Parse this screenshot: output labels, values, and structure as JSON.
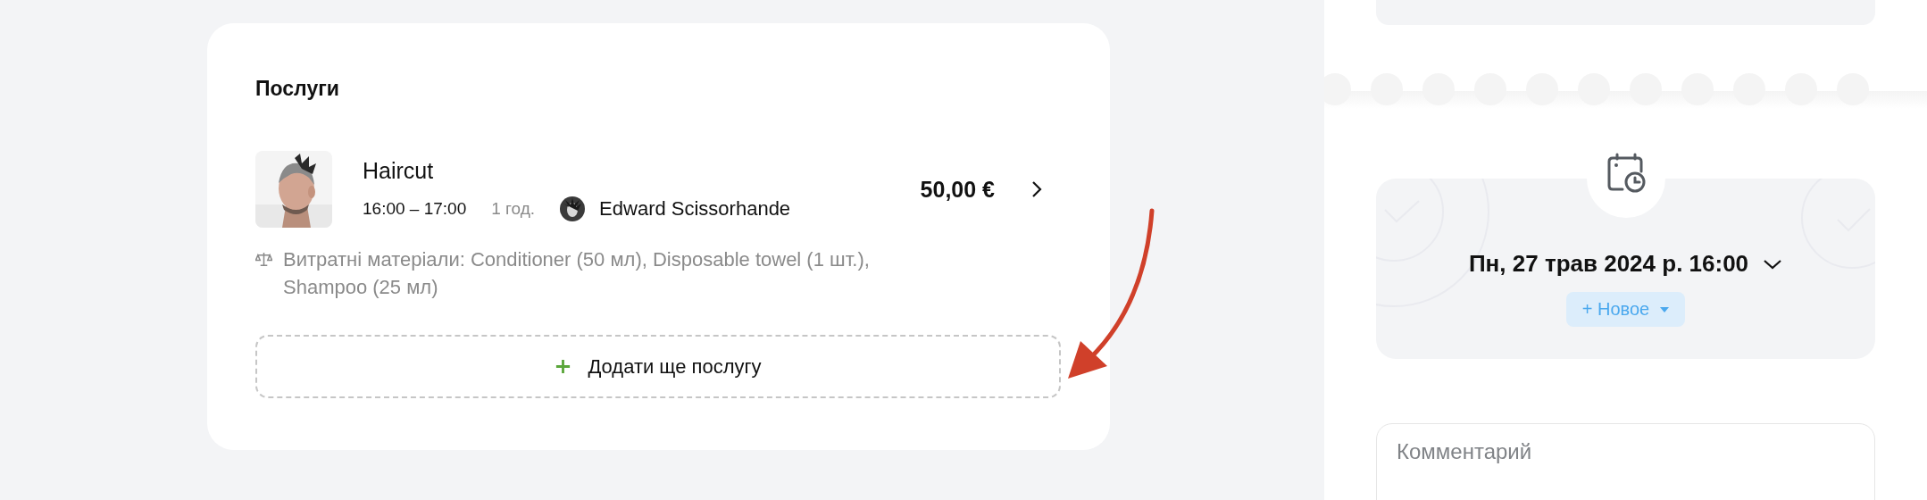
{
  "services": {
    "title": "Послуги",
    "items": [
      {
        "name": "Haircut",
        "time": "16:00 – 17:00",
        "duration": "1 год.",
        "staff": "Edward Scissorhande",
        "price": "50,00 €",
        "materials": "Витратні матеріали: Conditioner (50 мл), Disposable towel (1 шт.), Shampoo (25 мл)"
      }
    ],
    "add_button": "Додати ще послугу"
  },
  "appointment": {
    "datetime": "Пн, 27 трав 2024 р. 16:00",
    "status_button": "+ Новое"
  },
  "comment": {
    "placeholder": "Комментарий"
  }
}
